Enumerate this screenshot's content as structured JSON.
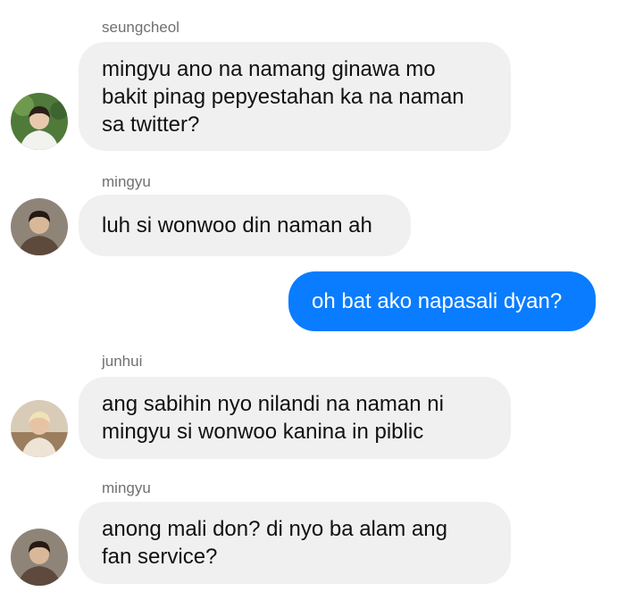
{
  "conversation": {
    "messages": [
      {
        "sender": "seungcheol",
        "avatar": "seungcheol-avatar",
        "text": "mingyu ano na namang ginawa mo\nbakit pinag pepyestahan ka na naman\nsa twitter?"
      },
      {
        "sender": "mingyu",
        "avatar": "mingyu-avatar",
        "text": "luh si wonwoo din naman ah"
      },
      {
        "sender": "",
        "avatar": "",
        "outgoing": true,
        "text": "oh bat ako napasali dyan?"
      },
      {
        "sender": "junhui",
        "avatar": "junhui-avatar",
        "text": "ang sabihin nyo nilandi na naman ni\nmingyu si wonwoo kanina in piblic"
      },
      {
        "sender": "mingyu",
        "avatar": "mingyu-avatar",
        "text": "anong mali don? di nyo ba alam ang\nfan service?"
      }
    ]
  },
  "colors": {
    "outgoing_bubble": "#0a7cff",
    "incoming_bubble": "#f0f0f0",
    "sender_name": "#707070"
  }
}
